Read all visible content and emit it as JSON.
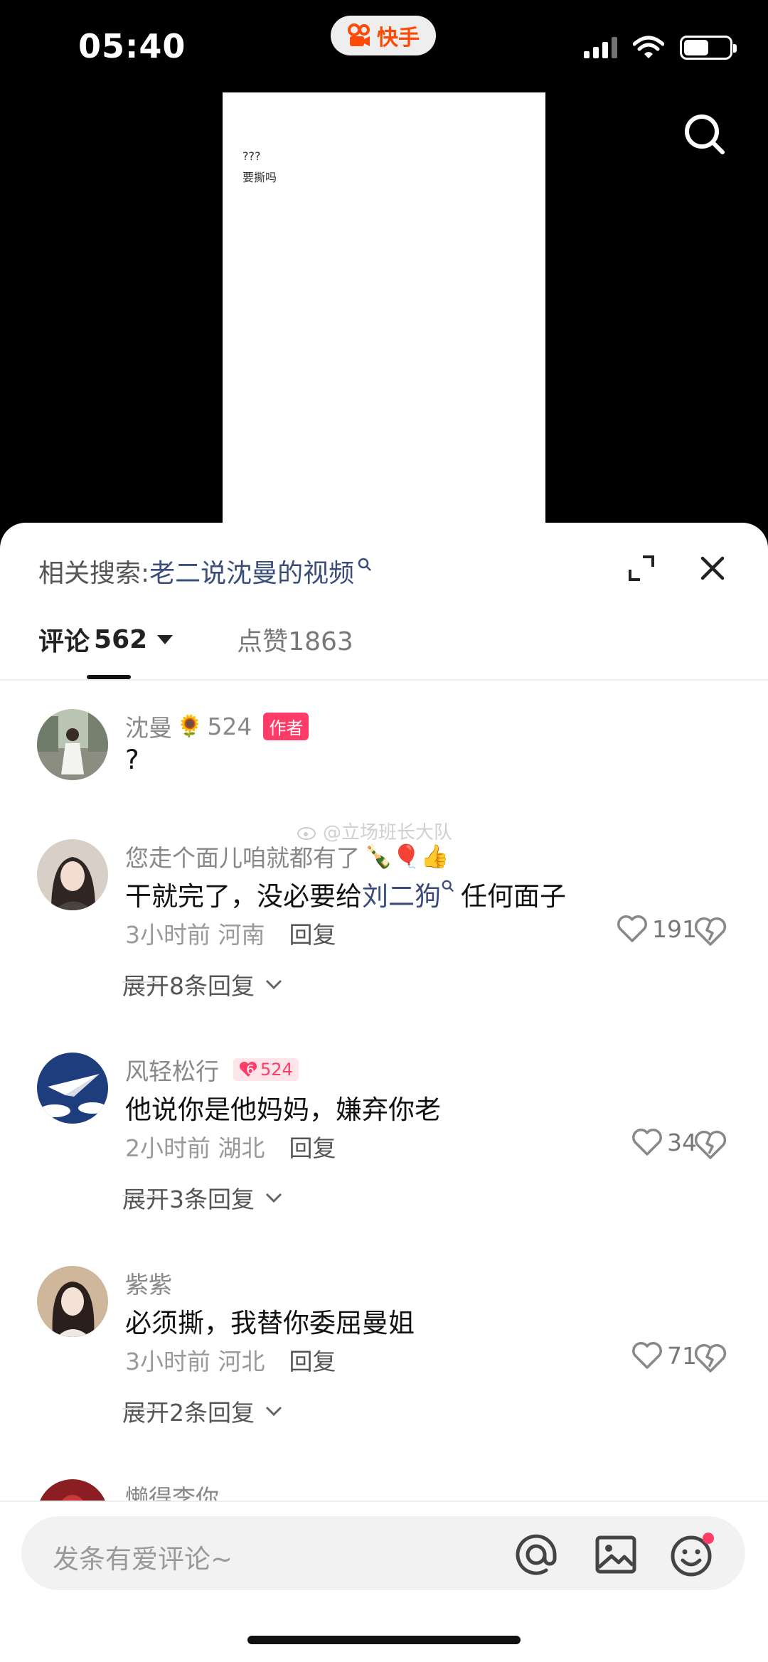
{
  "status_bar": {
    "time": "05:40",
    "app_name": "快手"
  },
  "video": {
    "line1": "???",
    "line2": "要撕吗"
  },
  "related_search": {
    "label": "相关搜索:",
    "query": "老二说沈曼的视频"
  },
  "tabs": {
    "comments_label": "评论",
    "comments_count": "562",
    "likes_label": "点赞",
    "likes_count": "1863"
  },
  "watermark": "@立场班长大队",
  "comments": [
    {
      "name": "沈曼",
      "name_suffix": "524",
      "badge": "作者",
      "text": "?",
      "avatar": "avatar-shenman"
    },
    {
      "name": "您走个面儿咱就都有了",
      "text_before": "干就完了，没必要给",
      "text_link": "刘二狗",
      "text_after": "任何面子",
      "time": "3小时前",
      "location": "河南",
      "reply": "回复",
      "likes": "191",
      "expand": "展开8条回复"
    },
    {
      "name": "风轻松行",
      "fan_level": "6",
      "fan_count": "524",
      "text": "他说你是他妈妈，嫌弃你老",
      "time": "2小时前",
      "location": "湖北",
      "reply": "回复",
      "likes": "34",
      "expand": "展开3条回复"
    },
    {
      "name": "紫紫",
      "text": "必须撕，我替你委屈曼姐",
      "time": "3小时前",
      "location": "河北",
      "reply": "回复",
      "likes": "71",
      "expand": "展开2条回复"
    },
    {
      "name": "懒得李你"
    }
  ],
  "input": {
    "placeholder": "发条有爱评论~"
  },
  "colors": {
    "accent": "#ff3b67",
    "link": "#3a4d7a",
    "kuaishou_orange": "#ff4906"
  }
}
